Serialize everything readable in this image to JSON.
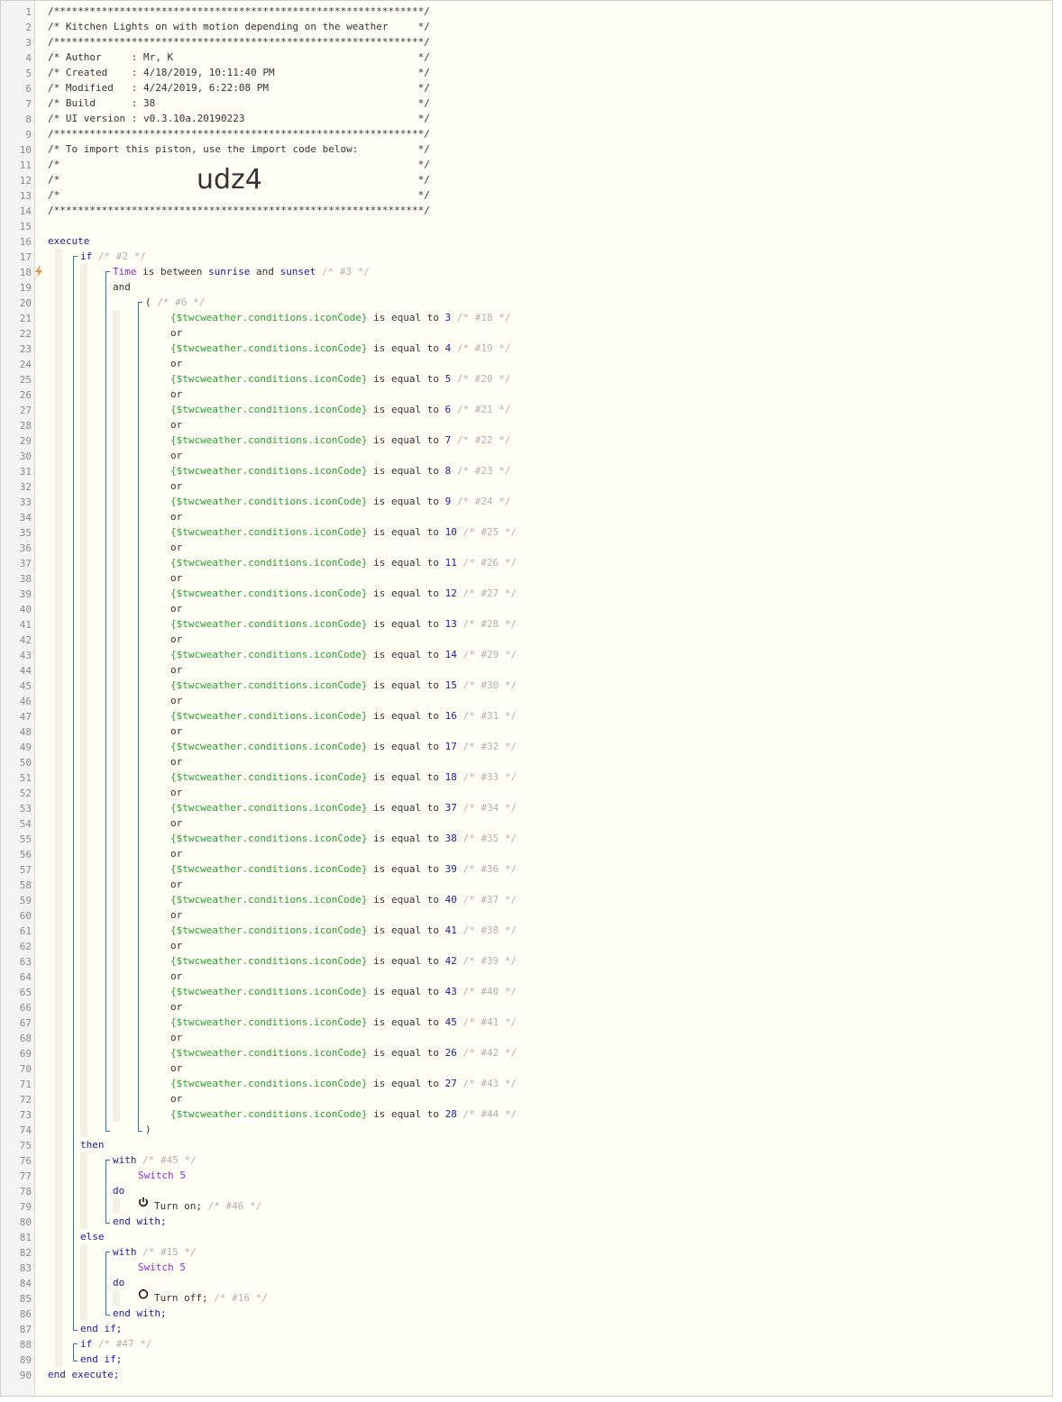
{
  "lines": [
    "/**************************************************************/",
    "/* Kitchen Lights on with motion depending on the weather     */",
    "/**************************************************************/",
    "/* Author     : Mr, K                                         */",
    "/* Created    : 4/18/2019, 10:11:40 PM                        */",
    "/* Modified   : 4/24/2019, 6:22:08 PM                         */",
    "/* Build      : 38                                            */",
    "/* UI version : v0.3.10a.20190223                             */",
    "/**************************************************************/",
    "/* To import this piston, use the import code below:          */",
    "/*                                                            */",
    "/*                                                            */",
    "/*                                                            */",
    "/**************************************************************/"
  ],
  "import_code": "udz4",
  "keywords": {
    "execute": "execute",
    "if": "if",
    "and": "and",
    "or": "or",
    "then": "then",
    "else": "else",
    "with": "with",
    "do": "do",
    "end_with": "end with;",
    "end_if": "end if;",
    "end_execute": "end execute;",
    "open_paren": "(",
    "close_paren": ")"
  },
  "condition_time": {
    "subject": "Time",
    "op": "is between",
    "a": "sunrise",
    "join": "and",
    "b": "sunset",
    "comment": "/* #3 */"
  },
  "comments": {
    "if1": "/* #2 */",
    "group": "/* #6 */",
    "with1": "/* #45 */",
    "act1": "/* #46 */",
    "with2": "/* #15 */",
    "act2": "/* #16 */",
    "if2": "/* #47 */"
  },
  "var": "{$twcweather.conditions.iconCode}",
  "op_equal": "is equal to",
  "conditions": [
    {
      "val": "3",
      "c": "/* #18 */"
    },
    {
      "val": "4",
      "c": "/* #19 */"
    },
    {
      "val": "5",
      "c": "/* #20 */"
    },
    {
      "val": "6",
      "c": "/* #21 */"
    },
    {
      "val": "7",
      "c": "/* #22 */"
    },
    {
      "val": "8",
      "c": "/* #23 */"
    },
    {
      "val": "9",
      "c": "/* #24 */"
    },
    {
      "val": "10",
      "c": "/* #25 */"
    },
    {
      "val": "11",
      "c": "/* #26 */"
    },
    {
      "val": "12",
      "c": "/* #27 */"
    },
    {
      "val": "13",
      "c": "/* #28 */"
    },
    {
      "val": "14",
      "c": "/* #29 */"
    },
    {
      "val": "15",
      "c": "/* #30 */"
    },
    {
      "val": "16",
      "c": "/* #31 */"
    },
    {
      "val": "17",
      "c": "/* #32 */"
    },
    {
      "val": "18",
      "c": "/* #33 */"
    },
    {
      "val": "37",
      "c": "/* #34 */"
    },
    {
      "val": "38",
      "c": "/* #35 */"
    },
    {
      "val": "39",
      "c": "/* #36 */"
    },
    {
      "val": "40",
      "c": "/* #37 */"
    },
    {
      "val": "41",
      "c": "/* #38 */"
    },
    {
      "val": "42",
      "c": "/* #39 */"
    },
    {
      "val": "43",
      "c": "/* #40 */"
    },
    {
      "val": "45",
      "c": "/* #41 */"
    },
    {
      "val": "26",
      "c": "/* #42 */"
    },
    {
      "val": "27",
      "c": "/* #43 */"
    },
    {
      "val": "28",
      "c": "/* #44 */"
    }
  ],
  "device": "Switch 5",
  "action_on": "Turn on;",
  "action_off": "Turn off;",
  "line_count": 90
}
